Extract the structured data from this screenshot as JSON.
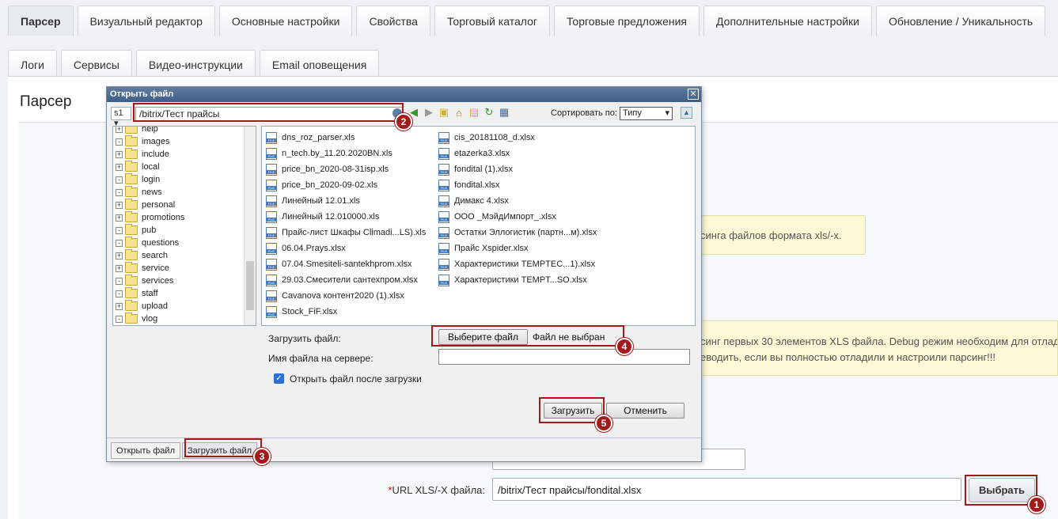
{
  "tabs_row1": [
    "Парсер",
    "Визуальный редактор",
    "Основные настройки",
    "Свойства",
    "Торговый каталог",
    "Торговые предложения",
    "Дополнительные настройки",
    "Обновление / Уникальность"
  ],
  "tabs_row2": [
    "Логи",
    "Сервисы",
    "Видео-инструкции",
    "Email оповещения"
  ],
  "panel": {
    "title": "Парсер",
    "note1": "синга файлов формата xls/-x.",
    "note2_line1": "синг первых 30 элементов XLS файла. Debug режим необходим для отлади",
    "note2_line2": "еводить, если вы полностью отладили и настроили парсинг!!!",
    "url_label_req": "*",
    "url_label": "URL XLS/-X файла:",
    "url_value": "/bitrix/Тест прайсы/fondital.xlsx",
    "choose_button": "Выбрать"
  },
  "dialog": {
    "title": "Открыть файл",
    "site": "s1",
    "path": "/bitrix/Тест прайсы",
    "sort_label": "Сортировать по:",
    "sort_value": "Типу",
    "tree": [
      {
        "name": "help",
        "toggle": "+"
      },
      {
        "name": "images",
        "toggle": "-"
      },
      {
        "name": "include",
        "toggle": "+"
      },
      {
        "name": "local",
        "toggle": "+"
      },
      {
        "name": "login",
        "toggle": "-"
      },
      {
        "name": "news",
        "toggle": "-"
      },
      {
        "name": "personal",
        "toggle": "+"
      },
      {
        "name": "promotions",
        "toggle": "+"
      },
      {
        "name": "pub",
        "toggle": "-"
      },
      {
        "name": "questions",
        "toggle": "-"
      },
      {
        "name": "search",
        "toggle": "+"
      },
      {
        "name": "service",
        "toggle": "+"
      },
      {
        "name": "services",
        "toggle": "-"
      },
      {
        "name": "staff",
        "toggle": "-"
      },
      {
        "name": "upload",
        "toggle": "+"
      },
      {
        "name": "vlog",
        "toggle": "-"
      }
    ],
    "files_col1": [
      "dns_roz_parser.xls",
      "n_tech.by_11.20.2020BN.xls",
      "price_bn_2020-08-31isp.xls",
      "price_bn_2020-09-02.xls",
      "Линейный 12.01.xls",
      "Линейный 12.010000.xls",
      "Прайс-лист Шкафы Climadi...LS).xls",
      "06.04.Prays.xlsx",
      "07.04.Smesiteli-santekhprom.xlsx",
      "29.03.Смесители сантехпром.xlsx",
      "Cavanova контент2020 (1).xlsx",
      "Stock_FiF.xlsx"
    ],
    "files_col2": [
      "cis_20181108_d.xlsx",
      "etazerka3.xlsx",
      "fondital (1).xlsx",
      "fondital.xlsx",
      "Димакс 4.xlsx",
      "ООО _МэйдИмпорт_.xlsx",
      "Остатки Эллогистик (партн...м).xlsx",
      "Прайс Xspider.xlsx",
      "Характеристики TEMPTEC...1).xlsx",
      "Характеристики TEMPT...SO.xlsx"
    ],
    "upload_label": "Загрузить файл:",
    "choose_file_button": "Выберите файл",
    "no_file_text": "Файл не выбран",
    "server_name_label": "Имя файла на сервере:",
    "open_after_upload": "Открыть файл после загрузки",
    "upload_button": "Загрузить",
    "cancel_button": "Отменить",
    "bottom_tabs": [
      "Открыть файл",
      "Загрузить файл"
    ]
  },
  "markers": [
    "1",
    "2",
    "3",
    "4",
    "5"
  ],
  "colors": {
    "marker": "#a31a1a",
    "note_bg": "#fdf8d5",
    "dialog_title": "#4a6a94"
  }
}
